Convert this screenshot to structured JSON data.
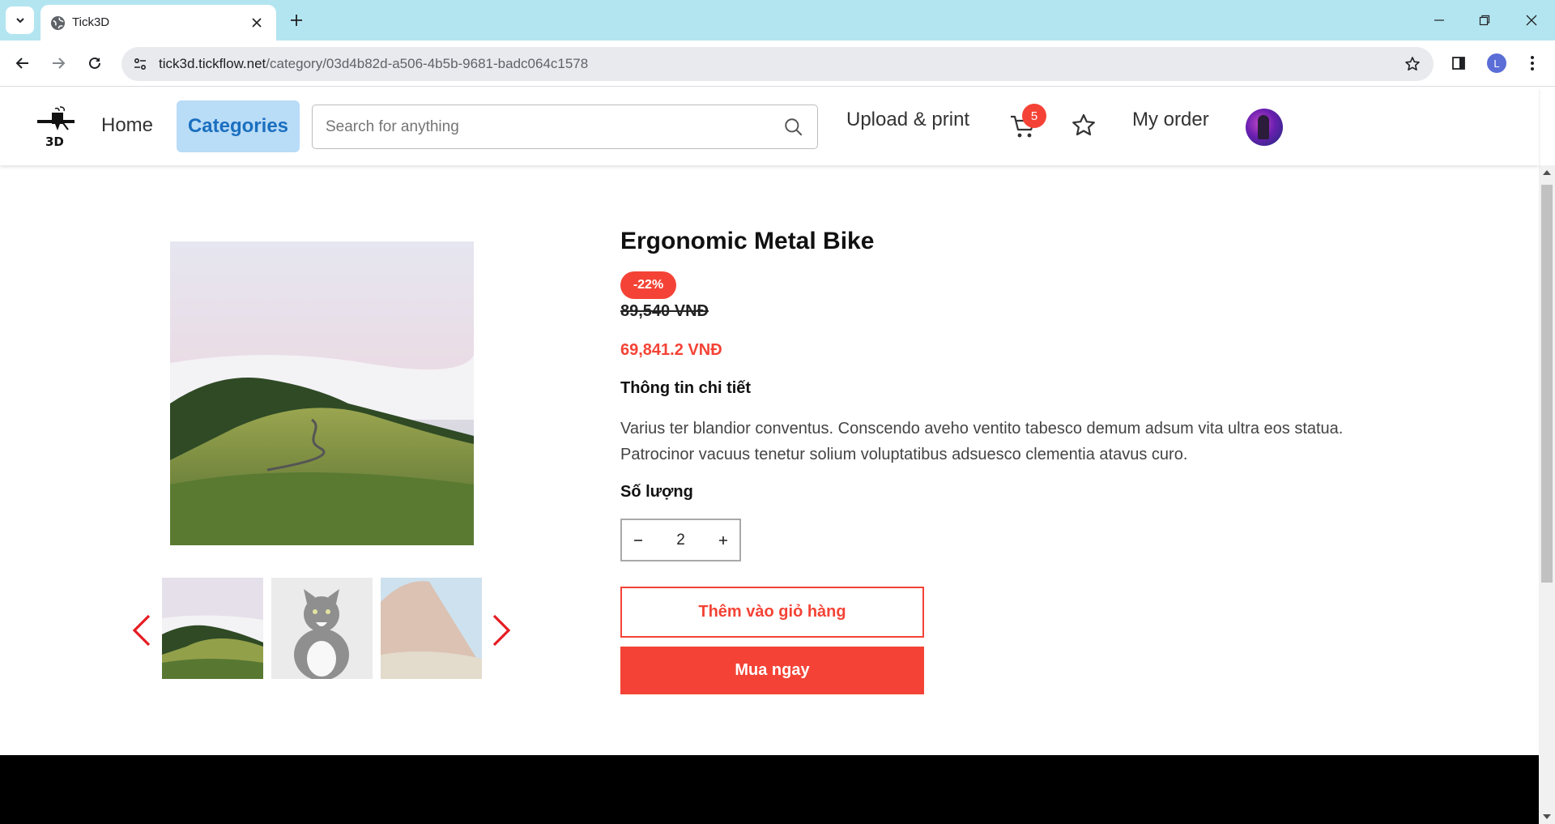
{
  "browser": {
    "tab_title": "Tick3D",
    "url_host": "tick3d.tickflow.net",
    "url_path": "/category/03d4b82d-a506-4b5b-9681-badc064c1578",
    "profile_initial": "L"
  },
  "header": {
    "nav_home": "Home",
    "nav_categories": "Categories",
    "search_placeholder": "Search for anything",
    "nav_upload": "Upload & print",
    "cart_count": "5",
    "nav_order": "My order"
  },
  "product": {
    "title": "Ergonomic Metal Bike",
    "discount": "-22%",
    "old_price": "89,540 VNĐ",
    "new_price": "69,841.2 VNĐ",
    "detail_heading": "Thông tin chi tiết",
    "description": "Varius ter blandior conventus. Conscendo aveho ventito tabesco demum adsum vita ultra eos statua. Patrocinor vacuus tenetur solium voluptatibus adsuesco clementia atavus curo.",
    "quantity_heading": "Số lượng",
    "quantity": "2",
    "add_to_cart": "Thêm vào giỏ hàng",
    "buy_now": "Mua ngay"
  },
  "colors": {
    "accent": "#f44336",
    "categories_bg": "#b9dcf7",
    "categories_text": "#1a6fbf",
    "tabbar": "#b3e5f0"
  }
}
